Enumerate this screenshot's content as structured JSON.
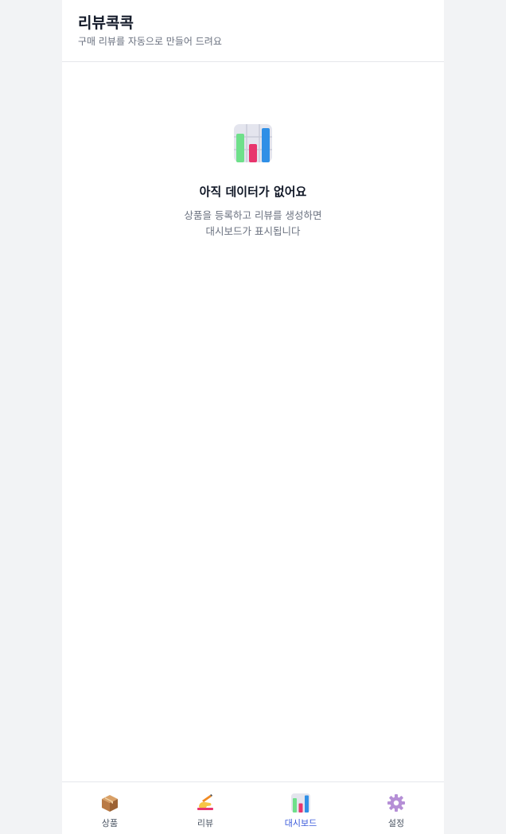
{
  "header": {
    "title": "리뷰콕콕",
    "subtitle": "구매 리뷰를 자동으로 만들어 드려요"
  },
  "empty_state": {
    "icon": "bar-chart-icon",
    "title": "아직 데이터가 없어요",
    "description_line1": "상품을 등록하고 리뷰를 생성하면",
    "description_line2": "대시보드가 표시됩니다"
  },
  "tabs": [
    {
      "label": "상품",
      "icon": "package-icon",
      "active": false
    },
    {
      "label": "리뷰",
      "icon": "writing-hand-icon",
      "active": false
    },
    {
      "label": "대시보드",
      "icon": "bar-chart-icon",
      "active": true
    },
    {
      "label": "설정",
      "icon": "gear-icon",
      "active": false
    }
  ],
  "colors": {
    "active_tab": "#3b5bdb",
    "page_background": "#f2f3f5"
  }
}
